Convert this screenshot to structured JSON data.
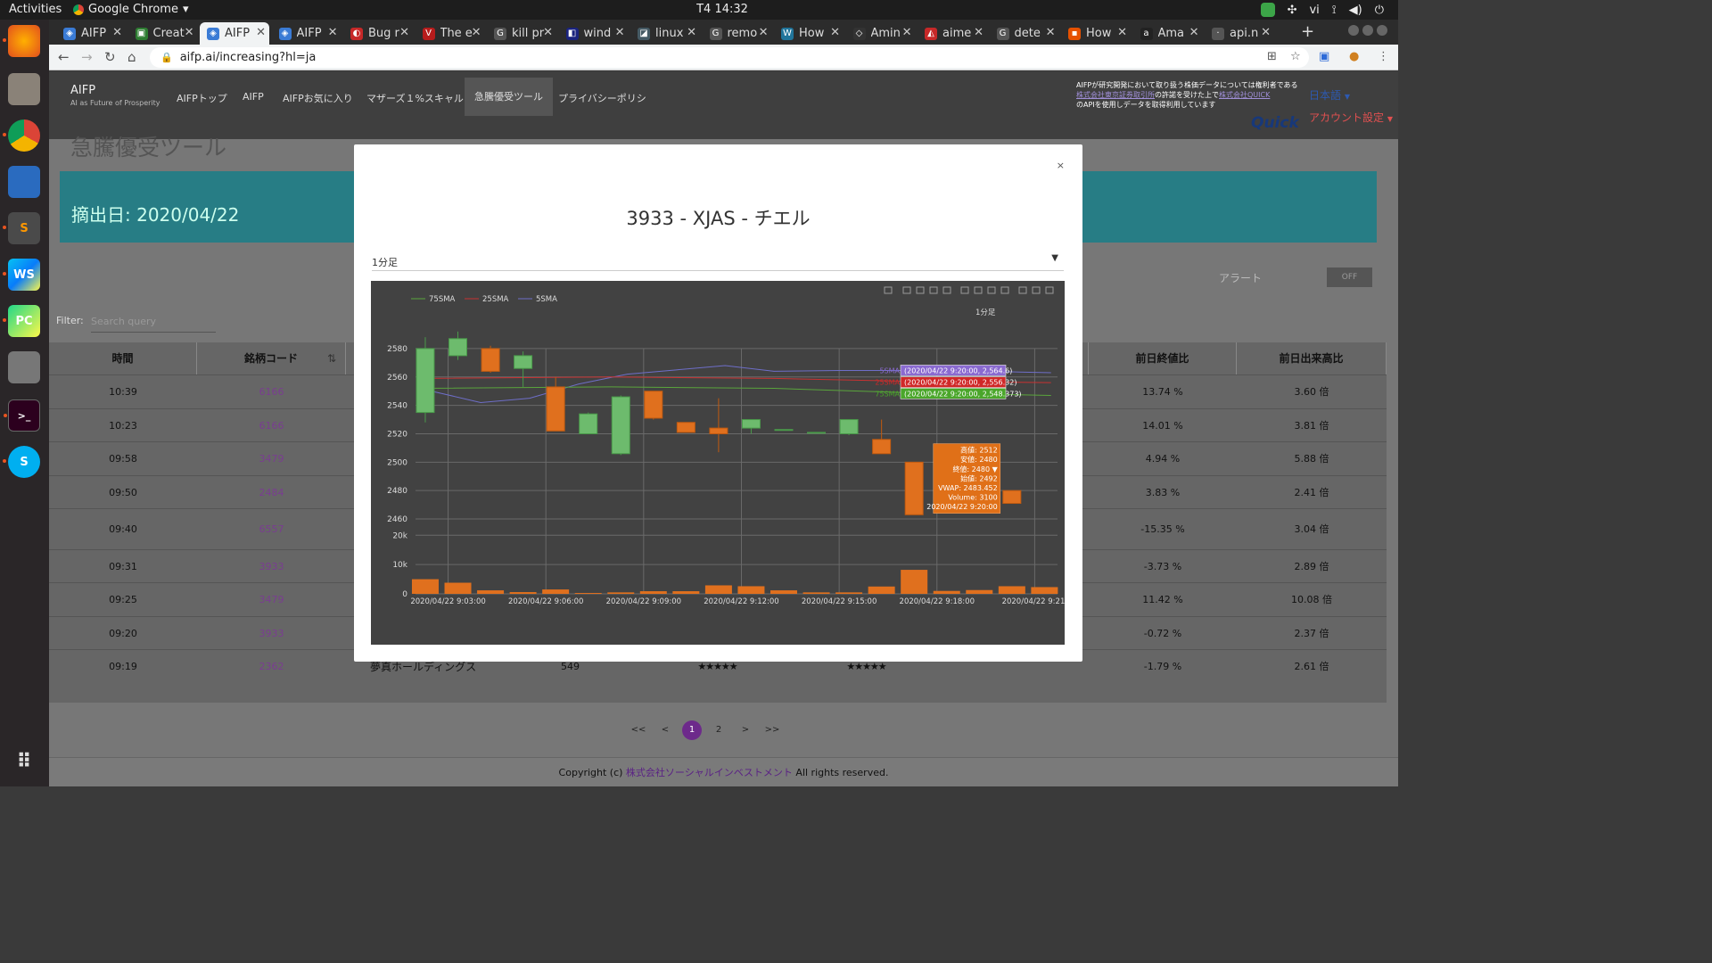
{
  "system": {
    "activities": "Activities",
    "app_name": "Google Chrome",
    "clock": "T4 14:32",
    "lang": "vi"
  },
  "dock": {
    "items": [
      "firefox-icon",
      "files-icon",
      "chrome-icon",
      "writer-icon",
      "sublime-icon",
      "webstorm-icon",
      "pycharm-icon",
      "camera-icon",
      "terminal-icon",
      "skype-icon",
      "app-grid-icon"
    ],
    "labels": {
      "webstorm": "WS",
      "pycharm": "PC",
      "sublime": "S",
      "skype": "S",
      "terminal": ">_"
    }
  },
  "tabs": [
    {
      "title": "AIFP",
      "color": "#3a7bd5"
    },
    {
      "title": "Creat",
      "color": "#2e7d32"
    },
    {
      "title": "AIFP",
      "color": "#3a7bd5"
    },
    {
      "title": "AIFP",
      "color": "#3a7bd5"
    },
    {
      "title": "Bug r",
      "color": "#c62828"
    },
    {
      "title": "The e",
      "color": "#b71c1c"
    },
    {
      "title": "kill pr",
      "color": "#555555"
    },
    {
      "title": "wind",
      "color": "#1a237e"
    },
    {
      "title": "linux",
      "color": "#455a64"
    },
    {
      "title": "remo",
      "color": "#555555"
    },
    {
      "title": "How",
      "color": "#21759b"
    },
    {
      "title": "Amin",
      "color": "#333333"
    },
    {
      "title": "aime",
      "color": "#c62828"
    },
    {
      "title": "dete",
      "color": "#555555"
    },
    {
      "title": "How",
      "color": "#e65100"
    },
    {
      "title": "Ama",
      "color": "#222222"
    },
    {
      "title": "api.n",
      "color": "#555555"
    }
  ],
  "tab_favicon_glyphs": [
    "◈",
    "▣",
    "◈",
    "◈",
    "◐",
    "V",
    "G",
    "◧",
    "◪",
    "G",
    "W",
    "◇",
    "◭",
    "G",
    "▪",
    "a",
    "·"
  ],
  "address": {
    "url": "aifp.ai/increasing?hl=ja"
  },
  "site": {
    "brand": "AIFP",
    "tagline": "AI as Future of Prosperity",
    "nav": [
      "AIFPトップ",
      "AIFP",
      "AIFPお気に入り",
      "マザーズ１%スキャル",
      "急騰優受ツール",
      "プライバシーポリシ"
    ],
    "notice_l1": "AIFPが研究開発において取り扱う株価データについては権利者である",
    "notice_l2a": "株式会社東京証券取引所",
    "notice_l2b": "の許諾を受けた上で",
    "notice_l2c": "株式会社QUICK",
    "notice_l3": "のAPIを使用しデータを取得利用しています",
    "quick_logo": "Quick",
    "language": "日本語",
    "account": "アカウント設定",
    "page_heading": "急騰優受ツール",
    "extraction_date": "摘出日: 2020/04/22",
    "alert_label": "アラート",
    "alert_toggle": "OFF",
    "filter_label": "Filter:",
    "filter_placeholder": "Search query"
  },
  "table": {
    "headers": [
      "時間",
      "銘柄コード",
      "",
      "",
      "",
      "",
      "",
      "前日終値比",
      "前日出来高比"
    ],
    "rows": [
      {
        "time": "10:39",
        "code": "6166",
        "name": "",
        "price": "",
        "stars1": "",
        "stars2": "",
        "chg": "13.74 %",
        "vol": "3.60 倍"
      },
      {
        "time": "10:23",
        "code": "6166",
        "name": "",
        "price": "",
        "stars1": "",
        "stars2": "",
        "chg": "14.01 %",
        "vol": "3.81 倍"
      },
      {
        "time": "09:58",
        "code": "3479",
        "name": "",
        "price": "",
        "stars1": "",
        "stars2": "",
        "chg": "4.94 %",
        "vol": "5.88 倍"
      },
      {
        "time": "09:50",
        "code": "2484",
        "name": "",
        "price": "",
        "stars1": "",
        "stars2": "",
        "chg": "3.83 %",
        "vol": "2.41 倍"
      },
      {
        "time": "09:40",
        "code": "6557",
        "name": "",
        "price": "",
        "stars1": "",
        "stars2": "",
        "chg": "-15.35 %",
        "vol": "3.04 倍"
      },
      {
        "time": "09:31",
        "code": "3933",
        "name": "",
        "price": "",
        "stars1": "",
        "stars2": "",
        "chg": "-3.73 %",
        "vol": "2.89 倍"
      },
      {
        "time": "09:25",
        "code": "3479",
        "name": "",
        "price": "",
        "stars1": "",
        "stars2": "",
        "chg": "11.42 %",
        "vol": "10.08 倍"
      },
      {
        "time": "09:20",
        "code": "3933",
        "name": "",
        "price": "",
        "stars1": "",
        "stars2": "",
        "chg": "-0.72 %",
        "vol": "2.37 倍"
      },
      {
        "time": "09:19",
        "code": "2362",
        "name": "夢真ホールディングス",
        "price": "549",
        "stars1": "★★★★★",
        "stars2": "★★★★★",
        "chg": "-1.79 %",
        "vol": "2.61 倍"
      }
    ]
  },
  "pager": [
    "<<",
    "<",
    "1",
    "2",
    ">",
    ">>"
  ],
  "footer": {
    "pre": "Copyright (c) ",
    "company": "株式会社ソーシャルインベストメント",
    "post": " All rights reserved."
  },
  "modal": {
    "close": "×",
    "title": "3933 - XJAS - チエル",
    "select_value": "1分足"
  },
  "chart_data": {
    "type": "candlestick",
    "period_label": "1分足",
    "legend": [
      "75SMA",
      "25SMA",
      "5SMA"
    ],
    "series_colors": {
      "75SMA": "#5aa53c",
      "25SMA": "#c83232",
      "5SMA": "#6e6ec8",
      "up": "#6dbb6d",
      "down": "#e0701e"
    },
    "price_axis": {
      "ticks": [
        2460,
        2480,
        2500,
        2520,
        2540,
        2560,
        2580
      ],
      "range": [
        2455,
        2590
      ]
    },
    "volume_axis": {
      "ticks": [
        0,
        10000,
        20000
      ],
      "tick_labels": [
        "0",
        "10k",
        "20k"
      ],
      "range": [
        0,
        21000
      ]
    },
    "x_tick_labels": [
      "2020/04/22 9:03:00",
      "2020/04/22 9:06:00",
      "2020/04/22 9:09:00",
      "2020/04/22 9:12:00",
      "2020/04/22 9:15:00",
      "2020/04/22 9:18:00",
      "2020/04/22 9:21:"
    ],
    "x_tick_minutes": [
      3,
      6,
      9,
      12,
      15,
      18,
      21
    ],
    "x_range_minutes": [
      2.0,
      21.7
    ],
    "candles": [
      {
        "t": 2.3,
        "o": 2535,
        "h": 2588,
        "l": 2528,
        "c": 2580
      },
      {
        "t": 3.3,
        "o": 2575,
        "h": 2592,
        "l": 2572,
        "c": 2587
      },
      {
        "t": 4.3,
        "o": 2580,
        "h": 2582,
        "l": 2563,
        "c": 2564
      },
      {
        "t": 5.3,
        "o": 2566,
        "h": 2578,
        "l": 2553,
        "c": 2575
      },
      {
        "t": 6.3,
        "o": 2553,
        "h": 2560,
        "l": 2522,
        "c": 2522
      },
      {
        "t": 7.3,
        "o": 2520,
        "h": 2535,
        "l": 2520,
        "c": 2534
      },
      {
        "t": 8.3,
        "o": 2506,
        "h": 2547,
        "l": 2505,
        "c": 2546
      },
      {
        "t": 9.3,
        "o": 2550,
        "h": 2550,
        "l": 2530,
        "c": 2531
      },
      {
        "t": 10.3,
        "o": 2528,
        "h": 2528,
        "l": 2521,
        "c": 2521
      },
      {
        "t": 11.3,
        "o": 2524,
        "h": 2545,
        "l": 2507,
        "c": 2520
      },
      {
        "t": 12.3,
        "o": 2524,
        "h": 2530,
        "l": 2520,
        "c": 2530
      },
      {
        "t": 13.3,
        "o": 2523,
        "h": 2523,
        "l": 2523,
        "c": 2523
      },
      {
        "t": 14.3,
        "o": 2521,
        "h": 2521,
        "l": 2521,
        "c": 2521
      },
      {
        "t": 15.3,
        "o": 2520,
        "h": 2530,
        "l": 2519,
        "c": 2530
      },
      {
        "t": 16.3,
        "o": 2516,
        "h": 2530,
        "l": 2506,
        "c": 2506
      },
      {
        "t": 17.3,
        "o": 2500,
        "h": 2500,
        "l": 2463,
        "c": 2463
      },
      {
        "t": 19.3,
        "o": 2493,
        "h": 2512,
        "l": 2480,
        "c": 2481
      },
      {
        "t": 20.3,
        "o": 2480,
        "h": 2480,
        "l": 2471,
        "c": 2471
      }
    ],
    "volumes": [
      {
        "t": 2.3,
        "v": 5000
      },
      {
        "t": 3.3,
        "v": 3800
      },
      {
        "t": 4.3,
        "v": 1200
      },
      {
        "t": 5.3,
        "v": 600
      },
      {
        "t": 6.3,
        "v": 1500
      },
      {
        "t": 7.3,
        "v": 300
      },
      {
        "t": 8.3,
        "v": 500
      },
      {
        "t": 9.3,
        "v": 900
      },
      {
        "t": 10.3,
        "v": 900
      },
      {
        "t": 11.3,
        "v": 2900
      },
      {
        "t": 12.3,
        "v": 2600
      },
      {
        "t": 13.3,
        "v": 1200
      },
      {
        "t": 14.3,
        "v": 500
      },
      {
        "t": 15.3,
        "v": 500
      },
      {
        "t": 16.3,
        "v": 2500
      },
      {
        "t": 17.3,
        "v": 8200
      },
      {
        "t": 18.3,
        "v": 1000
      },
      {
        "t": 19.3,
        "v": 1300
      },
      {
        "t": 20.3,
        "v": 2600
      },
      {
        "t": 21.3,
        "v": 2300
      }
    ],
    "sma": {
      "5SMA": [
        {
          "t": 2.5,
          "v": 2550
        },
        {
          "t": 4,
          "v": 2542
        },
        {
          "t": 5.5,
          "v": 2545
        },
        {
          "t": 7,
          "v": 2555
        },
        {
          "t": 8.5,
          "v": 2562
        },
        {
          "t": 10,
          "v": 2565
        },
        {
          "t": 11.5,
          "v": 2568
        },
        {
          "t": 13,
          "v": 2564
        },
        {
          "t": 15,
          "v": 2564.6
        },
        {
          "t": 17,
          "v": 2564.6
        },
        {
          "t": 19.5,
          "v": 2564
        },
        {
          "t": 21.5,
          "v": 2563
        }
      ],
      "25SMA": [
        {
          "t": 2.3,
          "v": 2559
        },
        {
          "t": 8,
          "v": 2560
        },
        {
          "t": 13,
          "v": 2559
        },
        {
          "t": 17,
          "v": 2557
        },
        {
          "t": 21.5,
          "v": 2556
        }
      ],
      "75SMA": [
        {
          "t": 2.3,
          "v": 2552
        },
        {
          "t": 8,
          "v": 2553
        },
        {
          "t": 13,
          "v": 2552
        },
        {
          "t": 17,
          "v": 2549
        },
        {
          "t": 21.5,
          "v": 2547
        }
      ]
    },
    "sma_tags": [
      {
        "name": "5SMA",
        "text": "(2020/04/22 9:20:00, 2,564.6)",
        "v": 2564.6
      },
      {
        "name": "25SMA",
        "text": "(2020/04/22 9:20:00, 2,556.32)",
        "v": 2556.32
      },
      {
        "name": "75SMA",
        "text": "(2020/04/22 9:20:00, 2,548.373)",
        "v": 2548.373
      }
    ],
    "tooltip": [
      "高値: 2512",
      "安値: 2480",
      "終値: 2480 ▼",
      "始値: 2492",
      "VWAP: 2483.452",
      "Volume: 3100",
      "2020/04/22 9:20:00"
    ],
    "grid": true
  }
}
